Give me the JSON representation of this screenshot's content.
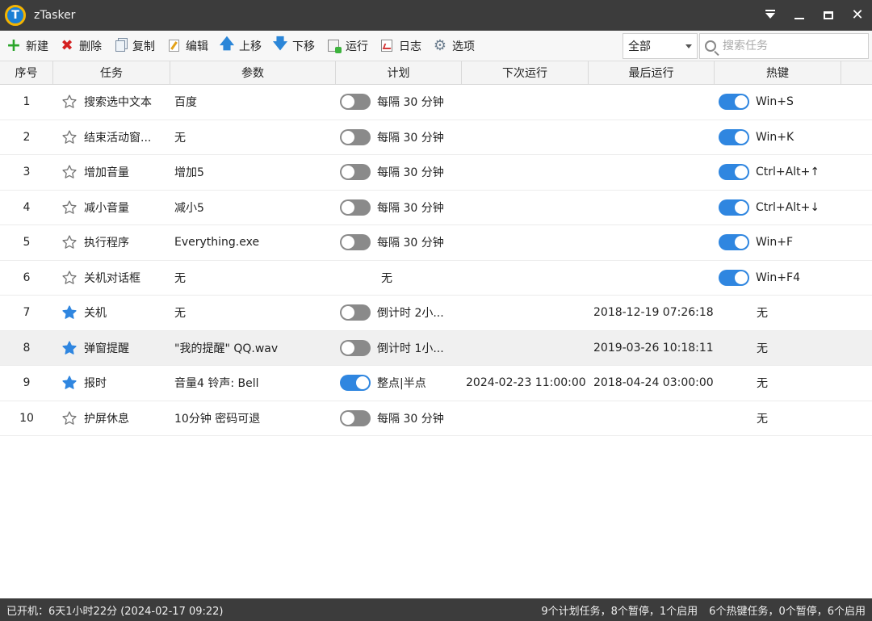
{
  "window": {
    "title": "zTasker",
    "logo_letter": "T"
  },
  "toolbar": {
    "new_label": "新建",
    "delete_label": "删除",
    "copy_label": "复制",
    "edit_label": "编辑",
    "move_up_label": "上移",
    "move_down_label": "下移",
    "run_label": "运行",
    "log_label": "日志",
    "options_label": "选项",
    "filter_value": "全部",
    "search_placeholder": "搜索任务"
  },
  "columns": {
    "no": "序号",
    "task": "任务",
    "param": "参数",
    "plan": "计划",
    "next_run": "下次运行",
    "last_run": "最后运行",
    "hotkey": "热键"
  },
  "rows": [
    {
      "no": "1",
      "starred": false,
      "task": "搜索选中文本",
      "param": "百度",
      "plan_toggle": "off",
      "plan": "每隔 30 分钟",
      "next_run": "",
      "last_run": "",
      "hotkey_toggle": "on",
      "hotkey": "Win+S"
    },
    {
      "no": "2",
      "starred": false,
      "task": "结束活动窗...",
      "param": "无",
      "plan_toggle": "off",
      "plan": "每隔 30 分钟",
      "next_run": "",
      "last_run": "",
      "hotkey_toggle": "on",
      "hotkey": "Win+K"
    },
    {
      "no": "3",
      "starred": false,
      "task": "增加音量",
      "param": "增加5",
      "plan_toggle": "off",
      "plan": "每隔 30 分钟",
      "next_run": "",
      "last_run": "",
      "hotkey_toggle": "on",
      "hotkey": "Ctrl+Alt+↑"
    },
    {
      "no": "4",
      "starred": false,
      "task": "减小音量",
      "param": "减小5",
      "plan_toggle": "off",
      "plan": "每隔 30 分钟",
      "next_run": "",
      "last_run": "",
      "hotkey_toggle": "on",
      "hotkey": "Ctrl+Alt+↓"
    },
    {
      "no": "5",
      "starred": false,
      "task": "执行程序",
      "param": "Everything.exe",
      "plan_toggle": "off",
      "plan": "每隔 30 分钟",
      "next_run": "",
      "last_run": "",
      "hotkey_toggle": "on",
      "hotkey": "Win+F"
    },
    {
      "no": "6",
      "starred": false,
      "task": "关机对话框",
      "param": "无",
      "plan_toggle": "none",
      "plan": "无",
      "next_run": "",
      "last_run": "",
      "hotkey_toggle": "on",
      "hotkey": "Win+F4"
    },
    {
      "no": "7",
      "starred": true,
      "task": "关机",
      "param": "无",
      "plan_toggle": "off",
      "plan": "倒计时 2小...",
      "next_run": "",
      "last_run": "2018-12-19 07:26:18",
      "hotkey_toggle": "none",
      "hotkey": "无"
    },
    {
      "no": "8",
      "starred": true,
      "task": "弹窗提醒",
      "param": "\"我的提醒\" QQ.wav",
      "plan_toggle": "off",
      "plan": "倒计时 1小...",
      "next_run": "",
      "last_run": "2019-03-26 10:18:11",
      "hotkey_toggle": "none",
      "hotkey": "无"
    },
    {
      "no": "9",
      "starred": true,
      "task": "报时",
      "param": "音量4 铃声: Bell",
      "plan_toggle": "on",
      "plan": "整点|半点",
      "next_run": "2024-02-23 11:00:00",
      "last_run": "2018-04-24 03:00:00",
      "hotkey_toggle": "none",
      "hotkey": "无"
    },
    {
      "no": "10",
      "starred": false,
      "task": "护屏休息",
      "param": "10分钟 密码可退",
      "plan_toggle": "off",
      "plan": "每隔 30 分钟",
      "next_run": "",
      "last_run": "",
      "hotkey_toggle": "none",
      "hotkey": "无"
    }
  ],
  "selected_row": "8",
  "status": {
    "uptime": "已开机：6天1小时22分 (2024-02-17 09:22)",
    "plan_summary": "9个计划任务，8个暂停，1个启用",
    "hotkey_summary": "6个热键任务，0个暂停，6个启用"
  },
  "colors": {
    "accent": "#2f86e0",
    "titlebar": "#3c3c3c",
    "toggle_off": "#8a8a8a"
  },
  "icons": {
    "new": "plus-icon",
    "delete": "x-icon",
    "copy": "copy-icon",
    "edit": "edit-icon",
    "move_up": "arrow-up-icon",
    "move_down": "arrow-down-icon",
    "run": "run-icon",
    "log": "log-icon",
    "options": "gear-icon",
    "search": "search-icon",
    "star": "star-icon"
  }
}
